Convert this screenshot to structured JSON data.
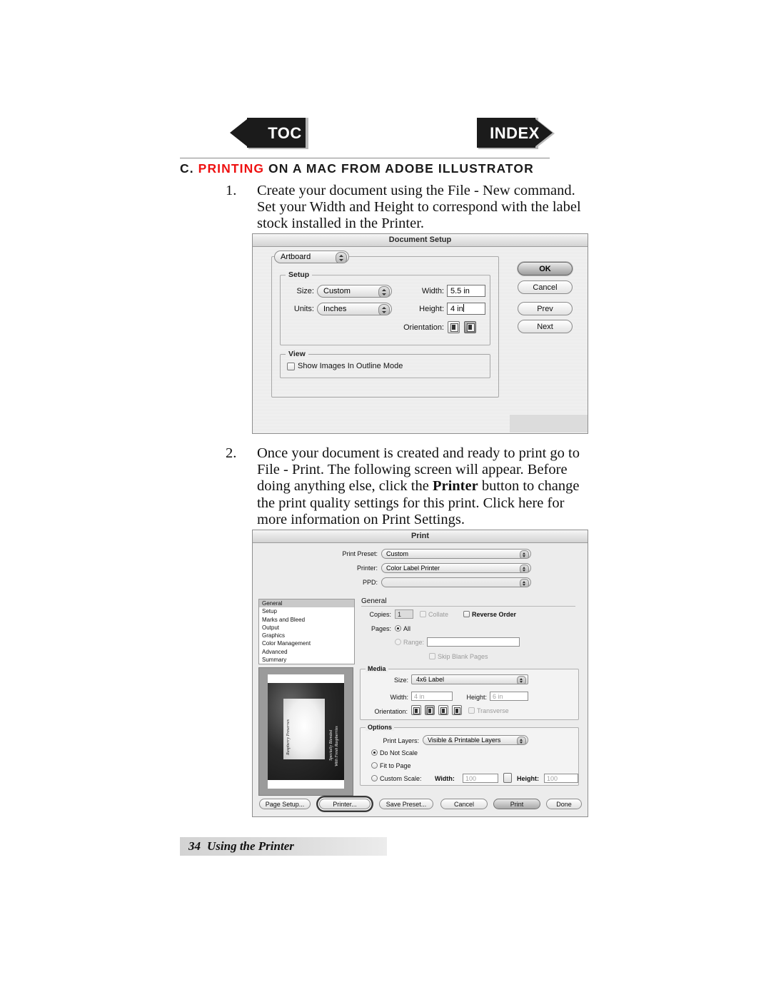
{
  "nav": {
    "toc": "TOC",
    "index": "INDEX"
  },
  "heading": {
    "prefix": "C. ",
    "red": "PRINTING",
    "suffix": " ON A MAC FROM ADOBE ILLUSTRATOR"
  },
  "steps": [
    {
      "number": "1.",
      "text": "Create your document using the File - New command. Set your Width and Height to correspond with the label stock installed in the Printer."
    },
    {
      "number": "2.",
      "part1": "Once your document is created and ready to print go to File - Print. The following screen will appear. Before doing anything else, click the ",
      "bold": "Printer",
      "part2": " button to change the print quality settings for this print. Click here for more information on Print Settings."
    }
  ],
  "document_setup": {
    "title": "Document Setup",
    "panel_popup": "Artboard",
    "setup_group": "Setup",
    "size_label": "Size:",
    "size_value": "Custom",
    "units_label": "Units:",
    "units_value": "Inches",
    "width_label": "Width:",
    "width_value": "5.5 in",
    "height_label": "Height:",
    "height_value": "4 in",
    "orientation_label": "Orientation:",
    "orientation_portrait": "portrait",
    "orientation_landscape": "landscape",
    "view_group": "View",
    "outline_mode_label": "Show Images In Outline Mode",
    "buttons": {
      "ok": "OK",
      "cancel": "Cancel",
      "prev": "Prev",
      "next": "Next"
    }
  },
  "print_dialog": {
    "title": "Print",
    "print_preset_label": "Print Preset:",
    "print_preset_value": "Custom",
    "printer_label": "Printer:",
    "printer_value": "Color Label Printer",
    "ppd_label": "PPD:",
    "ppd_value": "",
    "sidebar": [
      "General",
      "Setup",
      "Marks and Bleed",
      "Output",
      "Graphics",
      "Color Management",
      "Advanced",
      "Summary"
    ],
    "sidebar_selected": "General",
    "general": {
      "heading": "General",
      "copies_label": "Copies:",
      "copies_value": "1",
      "collate_label": "Collate",
      "reverse_order_label": "Reverse Order",
      "pages_label": "Pages:",
      "all_label": "All",
      "range_label": "Range:",
      "range_value": "",
      "skip_blank_label": "Skip Blank Pages"
    },
    "media": {
      "heading": "Media",
      "size_label": "Size:",
      "size_value": "4x6 Label",
      "width_label": "Width:",
      "width_value": "4 in",
      "height_label": "Height:",
      "height_value": "6 in",
      "orientation_label": "Orientation:",
      "transverse_label": "Transverse"
    },
    "options": {
      "heading": "Options",
      "print_layers_label": "Print Layers:",
      "print_layers_value": "Visible & Printable Layers",
      "do_not_scale_label": "Do Not Scale",
      "fit_to_page_label": "Fit to Page",
      "custom_scale_label": "Custom Scale:",
      "width_label": "Width:",
      "width_value": "100",
      "height_label": "Height:",
      "height_value": "100"
    },
    "preview": {
      "title_text": "Raspberry Preserves",
      "subtitle_line1": "Specially Blended",
      "subtitle_line2": "With Fresh Raspberries"
    },
    "buttons": {
      "page_setup": "Page Setup...",
      "printer": "Printer...",
      "save_preset": "Save Preset...",
      "cancel": "Cancel",
      "print": "Print",
      "done": "Done"
    }
  },
  "footer": {
    "page": "34",
    "title": "Using the Printer"
  },
  "colors": {
    "accent_red": "#ee1111",
    "arrow_fill": "#1b1b1b"
  }
}
